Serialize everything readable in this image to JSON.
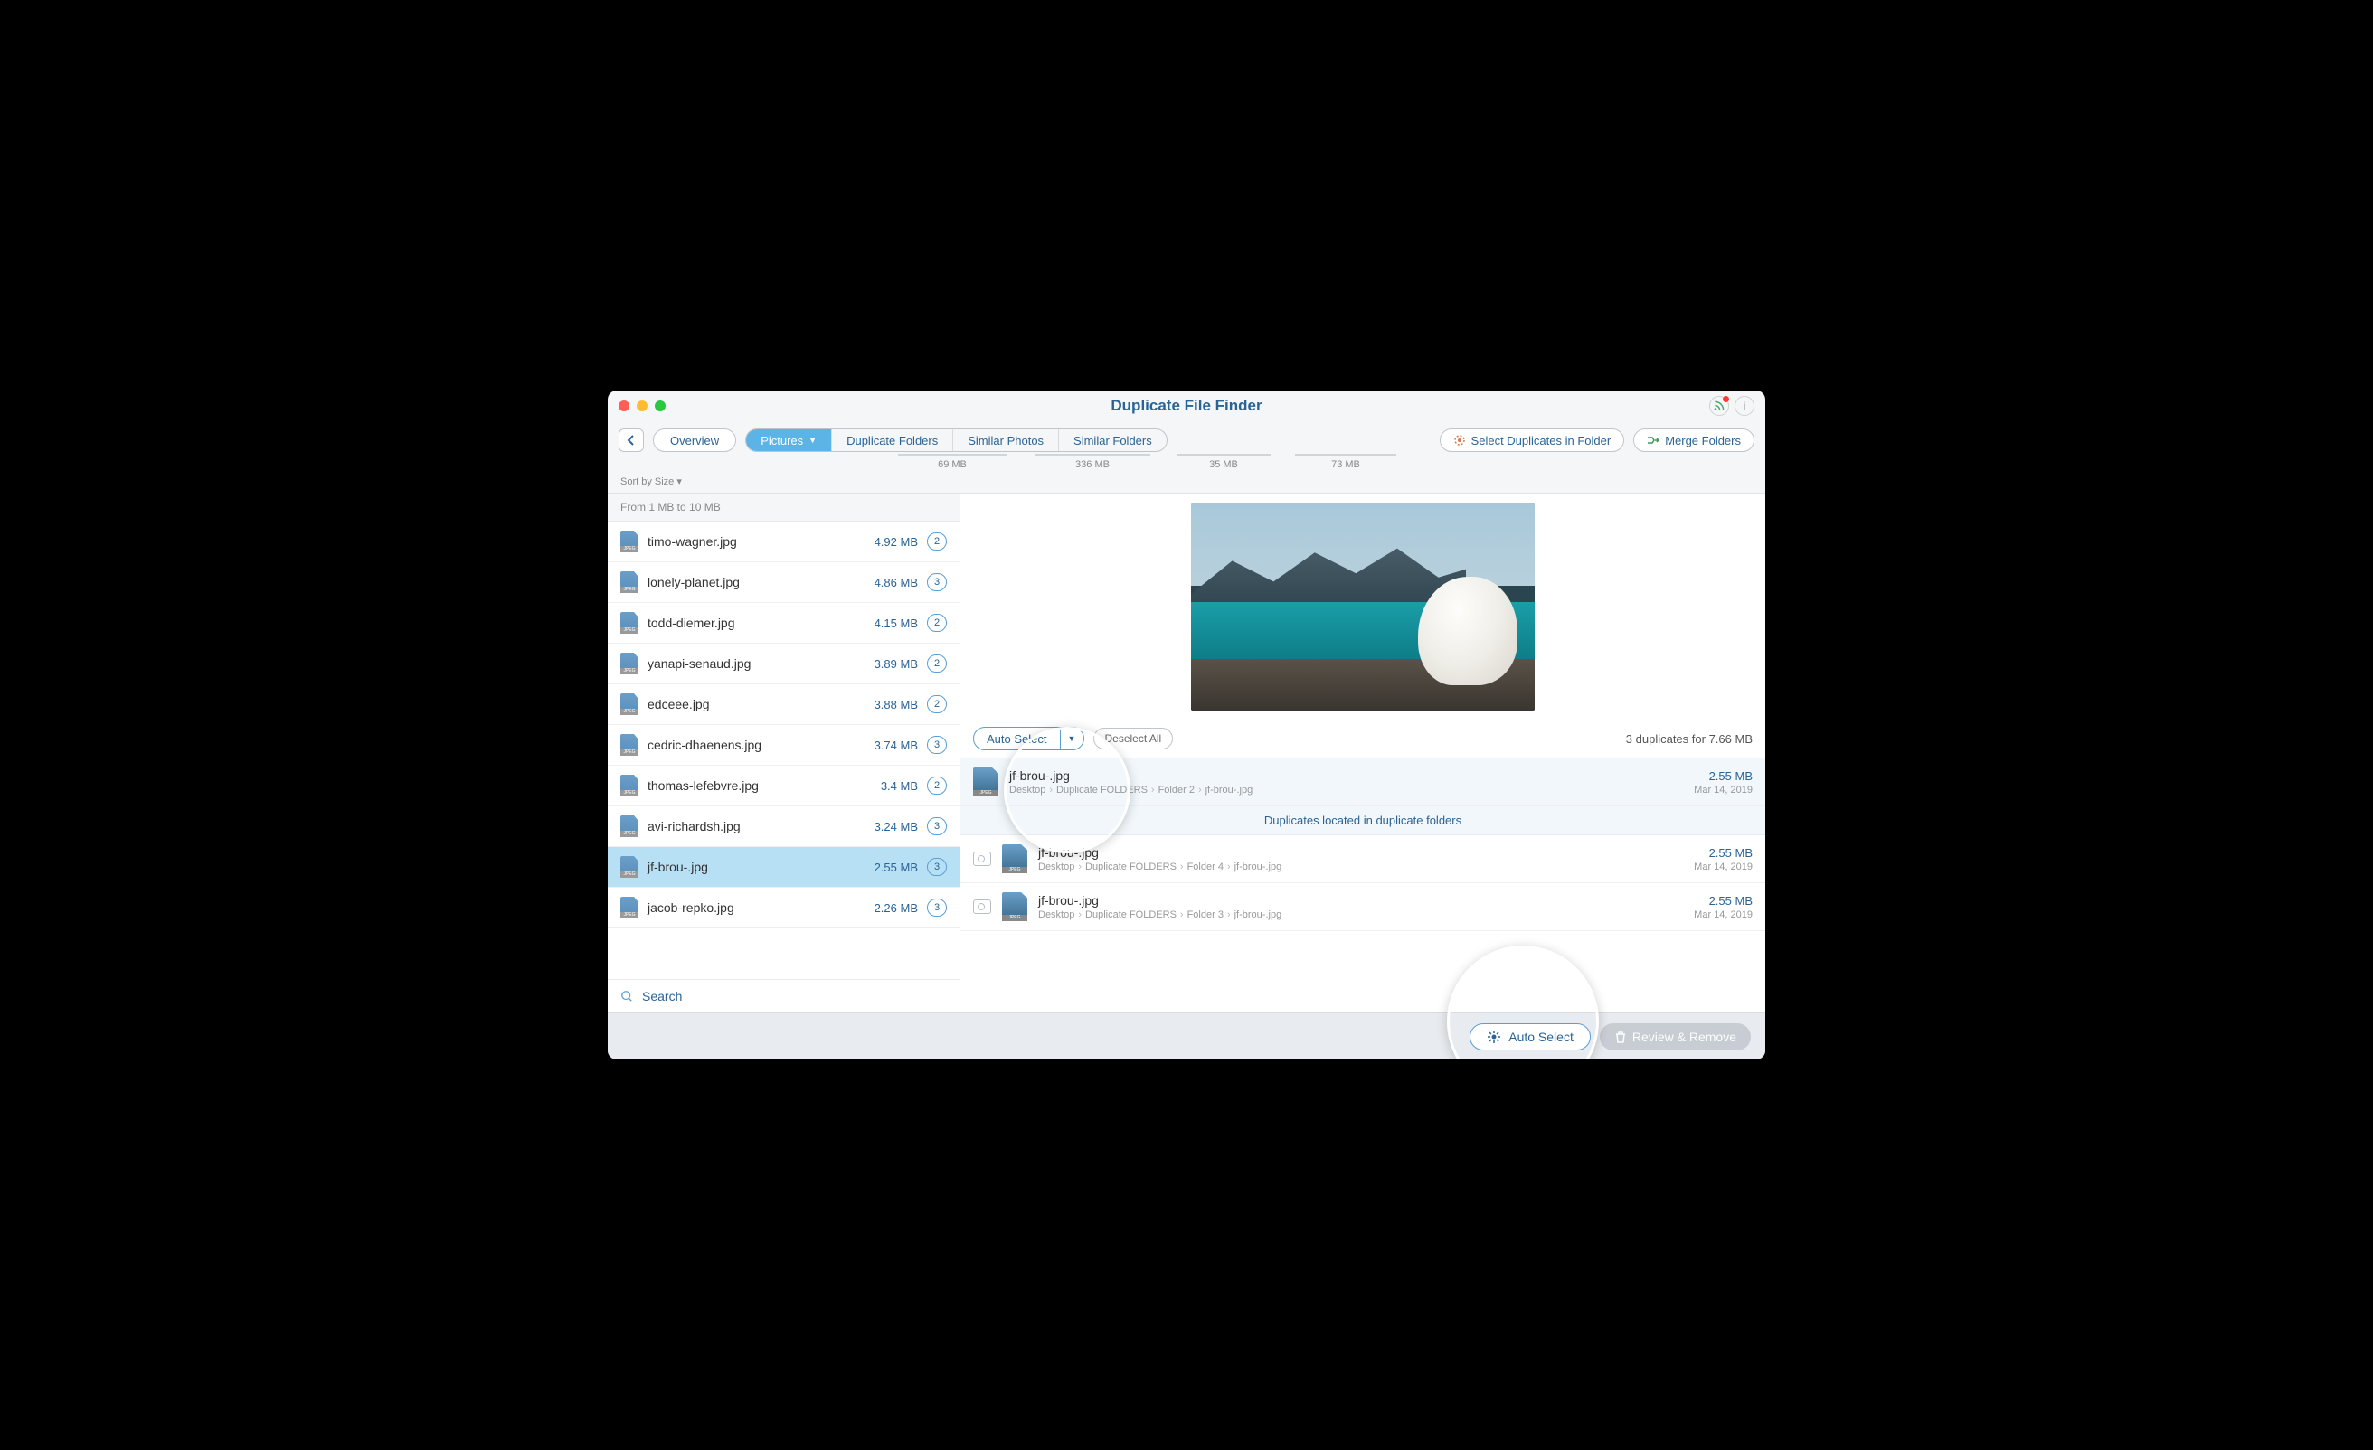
{
  "title": "Duplicate File Finder",
  "toolbar": {
    "overview": "Overview",
    "tabs": [
      "Pictures",
      "Duplicate Folders",
      "Similar Photos",
      "Similar Folders"
    ],
    "tab_sizes": [
      "69 MB",
      "336 MB",
      "35 MB",
      "73 MB"
    ],
    "select_in_folder": "Select Duplicates in Folder",
    "merge": "Merge Folders"
  },
  "sort": "Sort by Size",
  "size_group": "From 1 MB to 10 MB",
  "files": [
    {
      "name": "timo-wagner.jpg",
      "size": "4.92 MB",
      "count": "2"
    },
    {
      "name": "lonely-planet.jpg",
      "size": "4.86 MB",
      "count": "3"
    },
    {
      "name": "todd-diemer.jpg",
      "size": "4.15 MB",
      "count": "2"
    },
    {
      "name": "yanapi-senaud.jpg",
      "size": "3.89 MB",
      "count": "2"
    },
    {
      "name": "edceee.jpg",
      "size": "3.88 MB",
      "count": "2"
    },
    {
      "name": "cedric-dhaenens.jpg",
      "size": "3.74 MB",
      "count": "3"
    },
    {
      "name": "thomas-lefebvre.jpg",
      "size": "3.4 MB",
      "count": "2"
    },
    {
      "name": "avi-richardsh.jpg",
      "size": "3.24 MB",
      "count": "3"
    },
    {
      "name": "jf-brou-.jpg",
      "size": "2.55 MB",
      "count": "3"
    },
    {
      "name": "jacob-repko.jpg",
      "size": "2.26 MB",
      "count": "3"
    }
  ],
  "search": "Search",
  "detail": {
    "auto_select": "Auto Select",
    "deselect": "Deselect All",
    "summary": "3 duplicates for 7.66 MB",
    "banner": "Duplicates located in duplicate folders",
    "items": [
      {
        "name": "jf-brou-.jpg",
        "path": [
          "Desktop",
          "Duplicate FOLDERS",
          "Folder 2",
          "jf-brou-.jpg"
        ],
        "size": "2.55 MB",
        "date": "Mar 14, 2019",
        "hl": true
      },
      {
        "name": "jf-brou-.jpg",
        "path": [
          "Desktop",
          "Duplicate FOLDERS",
          "Folder 4",
          "jf-brou-.jpg"
        ],
        "size": "2.55 MB",
        "date": "Mar 14, 2019",
        "hl": false
      },
      {
        "name": "jf-brou-.jpg",
        "path": [
          "Desktop",
          "Duplicate FOLDERS",
          "Folder 3",
          "jf-brou-.jpg"
        ],
        "size": "2.55 MB",
        "date": "Mar 14, 2019",
        "hl": false
      }
    ]
  },
  "footer": {
    "auto": "Auto Select",
    "review": "Review & Remove"
  }
}
